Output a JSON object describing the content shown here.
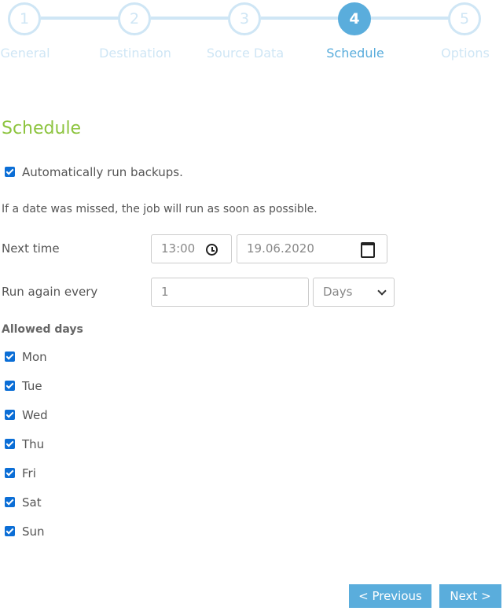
{
  "stepper": {
    "steps": [
      {
        "number": "1",
        "label": "General",
        "active": false
      },
      {
        "number": "2",
        "label": "Destination",
        "active": false
      },
      {
        "number": "3",
        "label": "Source Data",
        "active": false
      },
      {
        "number": "4",
        "label": "Schedule",
        "active": true
      },
      {
        "number": "5",
        "label": "Options",
        "active": false
      }
    ]
  },
  "schedule": {
    "title": "Schedule",
    "auto_run_label": "Automatically run backups.",
    "auto_run_checked": true,
    "missed_info": "If a date was missed, the job will run as soon as possible.",
    "next_time_label": "Next time",
    "next_time_value": "13:00",
    "next_date_value": "19.06.2020",
    "run_again_label": "Run again every",
    "run_again_value": "1",
    "run_again_unit": "Days",
    "allowed_days_label": "Allowed days",
    "days": [
      {
        "label": "Mon",
        "checked": true
      },
      {
        "label": "Tue",
        "checked": true
      },
      {
        "label": "Wed",
        "checked": true
      },
      {
        "label": "Thu",
        "checked": true
      },
      {
        "label": "Fri",
        "checked": true
      },
      {
        "label": "Sat",
        "checked": true
      },
      {
        "label": "Sun",
        "checked": true
      }
    ]
  },
  "nav": {
    "previous_label": "< Previous",
    "next_label": "Next >"
  },
  "colors": {
    "accent": "#5aaddc",
    "step_inactive": "#cfe6f5",
    "title_green": "#8dc43f",
    "checkbox_blue": "#0b6ed6"
  }
}
